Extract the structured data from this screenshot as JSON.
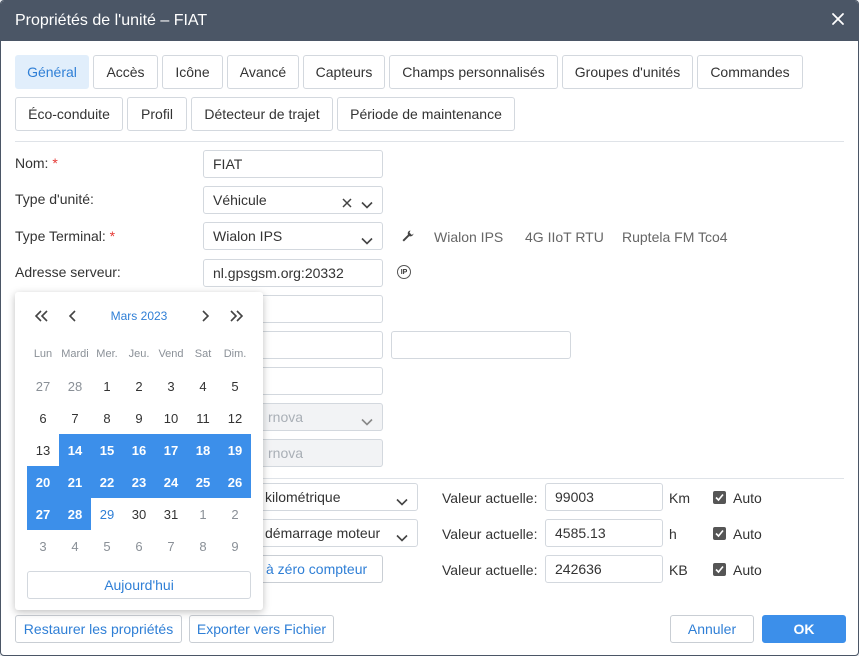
{
  "dialog": {
    "title": "Propriétés de l'unité – FIAT"
  },
  "tabs": [
    {
      "label": "Général"
    },
    {
      "label": "Accès"
    },
    {
      "label": "Icône"
    },
    {
      "label": "Avancé"
    },
    {
      "label": "Capteurs"
    },
    {
      "label": "Champs personnalisés"
    },
    {
      "label": "Groupes d'unités"
    },
    {
      "label": "Commandes"
    },
    {
      "label": "Éco-conduite"
    },
    {
      "label": "Profil"
    },
    {
      "label": "Détecteur de trajet"
    },
    {
      "label": "Période de maintenance"
    }
  ],
  "form": {
    "name": {
      "label": "Nom:",
      "required": "*",
      "value": "FIAT"
    },
    "unit_type": {
      "label": "Type d'unité:",
      "value": "Véhicule"
    },
    "terminal_type": {
      "label": "Type Terminal:",
      "required": "*",
      "value": "Wialon IPS",
      "suggestions": [
        "Wialon IPS",
        "4G IIoT RTU",
        "Ruptela FM Tco4"
      ]
    },
    "server_address": {
      "label": "Adresse serveur:",
      "value": "nl.gpsgsm.org:20332",
      "icon_text": "IP"
    },
    "hidden_select_1": "rnova",
    "hidden_select_2": "rnova"
  },
  "counters": {
    "mileage_select": "kilométrique",
    "engine_select": "démarrage moteur",
    "reset_button": "à zéro compteur",
    "rows": [
      {
        "label": "Valeur actuelle:",
        "value": "99003",
        "unit": "Km",
        "auto": "Auto"
      },
      {
        "label": "Valeur actuelle:",
        "value": "4585.13",
        "unit": "h",
        "auto": "Auto"
      },
      {
        "label": "Valeur actuelle:",
        "value": "242636",
        "unit": "KB",
        "auto": "Auto"
      }
    ]
  },
  "calendar": {
    "month": "Mars 2023",
    "weekdays": [
      "Lun",
      "Mardi",
      "Mer.",
      "Jeu.",
      "Vend",
      "Sat",
      "Dim."
    ],
    "weeks": [
      [
        "27",
        "28",
        "1",
        "2",
        "3",
        "4",
        "5"
      ],
      [
        "6",
        "7",
        "8",
        "9",
        "10",
        "11",
        "12"
      ],
      [
        "13",
        "14",
        "15",
        "16",
        "17",
        "18",
        "19"
      ],
      [
        "20",
        "21",
        "22",
        "23",
        "24",
        "25",
        "26"
      ],
      [
        "27",
        "28",
        "29",
        "30",
        "31",
        "1",
        "2"
      ],
      [
        "3",
        "4",
        "5",
        "6",
        "7",
        "8",
        "9"
      ]
    ],
    "today_button": "Aujourd'hui"
  },
  "footer": {
    "restore": "Restaurer les propriétés",
    "export": "Exporter vers Fichier",
    "cancel": "Annuler",
    "ok": "OK"
  },
  "colors": {
    "title_bar": "#4b5666",
    "accent": "#3c8fea",
    "link": "#2f7fd6",
    "active_tab": "#e1eefb"
  }
}
